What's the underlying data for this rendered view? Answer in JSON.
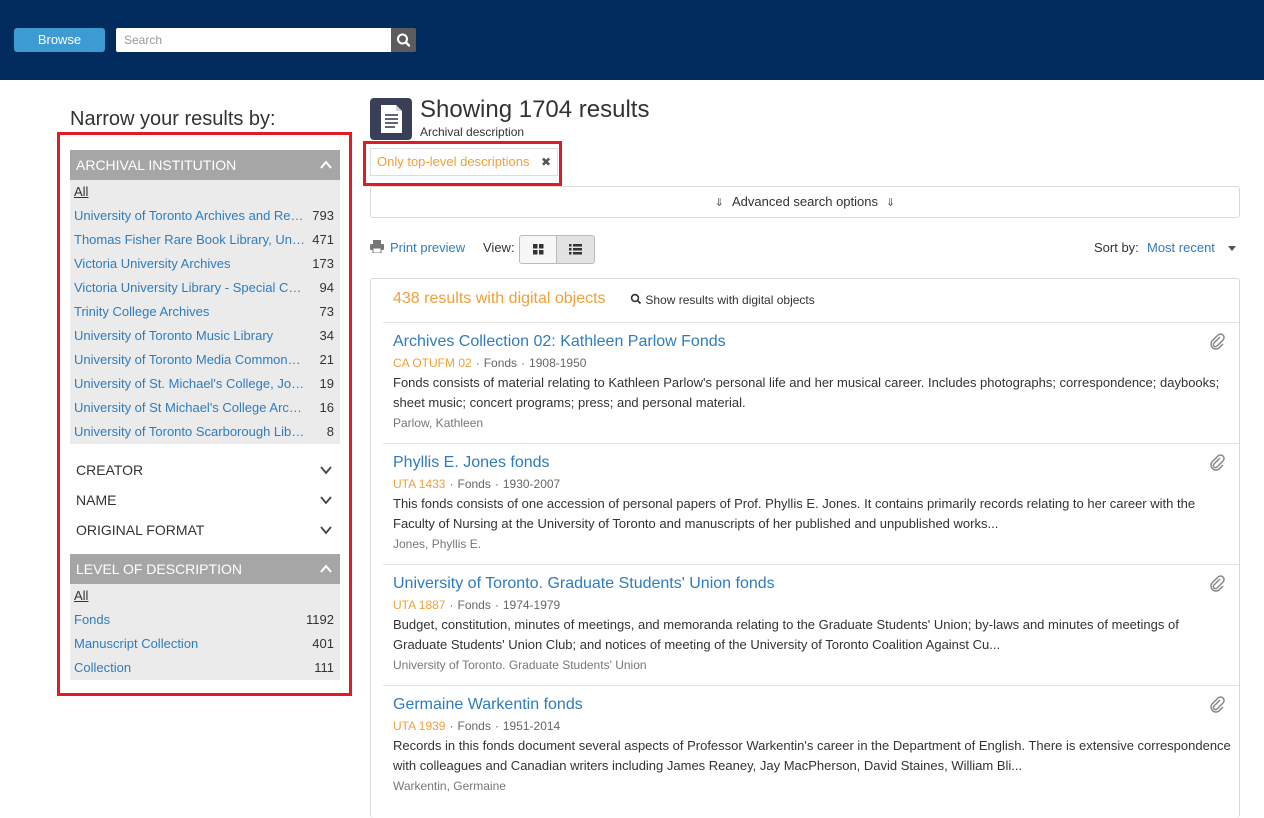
{
  "header": {
    "browse_label": "Browse",
    "search_placeholder": "Search"
  },
  "sidebar": {
    "title": "Narrow your results by:",
    "archival_institution": {
      "label": "ARCHIVAL INSTITUTION",
      "all_label": "All",
      "items": [
        {
          "label": "University of Toronto Archives and Records Management Services",
          "count": "793"
        },
        {
          "label": "Thomas Fisher Rare Book Library, University of Toronto",
          "count": "471"
        },
        {
          "label": "Victoria University Archives",
          "count": "173"
        },
        {
          "label": "Victoria University Library - Special Collections",
          "count": "94"
        },
        {
          "label": "Trinity College Archives",
          "count": "73"
        },
        {
          "label": "University of Toronto Music Library",
          "count": "34"
        },
        {
          "label": "University of Toronto Media Commons Archives",
          "count": "21"
        },
        {
          "label": "University of St. Michael's College, John M. Kelly Library",
          "count": "19"
        },
        {
          "label": "University of St Michael's College Archives",
          "count": "16"
        },
        {
          "label": "University of Toronto Scarborough Library",
          "count": "8"
        }
      ]
    },
    "creator_label": "CREATOR",
    "name_label": "NAME",
    "original_format_label": "ORIGINAL FORMAT",
    "level_of_description": {
      "label": "LEVEL OF DESCRIPTION",
      "all_label": "All",
      "items": [
        {
          "label": "Fonds",
          "count": "1192"
        },
        {
          "label": "Manuscript Collection",
          "count": "401"
        },
        {
          "label": "Collection",
          "count": "111"
        }
      ]
    }
  },
  "main": {
    "title": "Showing 1704 results",
    "subtitle": "Archival description",
    "filter_tag": "Only top-level descriptions",
    "advanced_search": "Advanced search options",
    "print_preview": "Print preview",
    "view_label": "View:",
    "sort_label": "Sort by:",
    "sort_value": "Most recent",
    "digital_count": "438 results with digital objects",
    "digital_link": "Show results with digital objects",
    "results": [
      {
        "title": "Archives Collection 02: Kathleen Parlow Fonds",
        "ref": "CA OTUFM 02",
        "level": "Fonds",
        "dates": "1908-1950",
        "description": "Fonds consists of material relating to Kathleen Parlow's personal life and her musical career. Includes photographs; correspondence; daybooks; sheet music; concert programs; press; and personal material.",
        "creator": "Parlow, Kathleen"
      },
      {
        "title": "Phyllis E. Jones fonds",
        "ref": "UTA 1433",
        "level": "Fonds",
        "dates": "1930-2007",
        "description": "This fonds consists of one accession of personal papers of Prof. Phyllis E. Jones. It contains primarily records relating to her career with the Faculty of Nursing at the University of Toronto and manuscripts of her published and unpublished works...",
        "creator": "Jones, Phyllis E."
      },
      {
        "title": "University of Toronto. Graduate Students' Union fonds",
        "ref": "UTA 1887",
        "level": "Fonds",
        "dates": "1974-1979",
        "description": "Budget, constitution, minutes of meetings, and memoranda relating to the Graduate Students' Union; by-laws and minutes of meetings of Graduate Students' Union Club; and notices of meeting of the University of Toronto Coalition Against Cu...",
        "creator": "University of Toronto. Graduate Students' Union"
      },
      {
        "title": "Germaine Warkentin fonds",
        "ref": "UTA 1939",
        "level": "Fonds",
        "dates": "1951-2014",
        "description": "Records in this fonds document several aspects of Professor Warkentin's career in the Department of English. There is extensive correspondence with colleagues and Canadian writers including James Reaney, Jay MacPherson, David Staines, William Bli...",
        "creator": "Warkentin, Germaine"
      }
    ]
  },
  "colors": {
    "header_bg": "#022c5e",
    "link": "#2e7cbf",
    "accent_orange": "#f0a03a",
    "highlight_red": "#e01b24",
    "facet_header": "#a6a6a6"
  }
}
